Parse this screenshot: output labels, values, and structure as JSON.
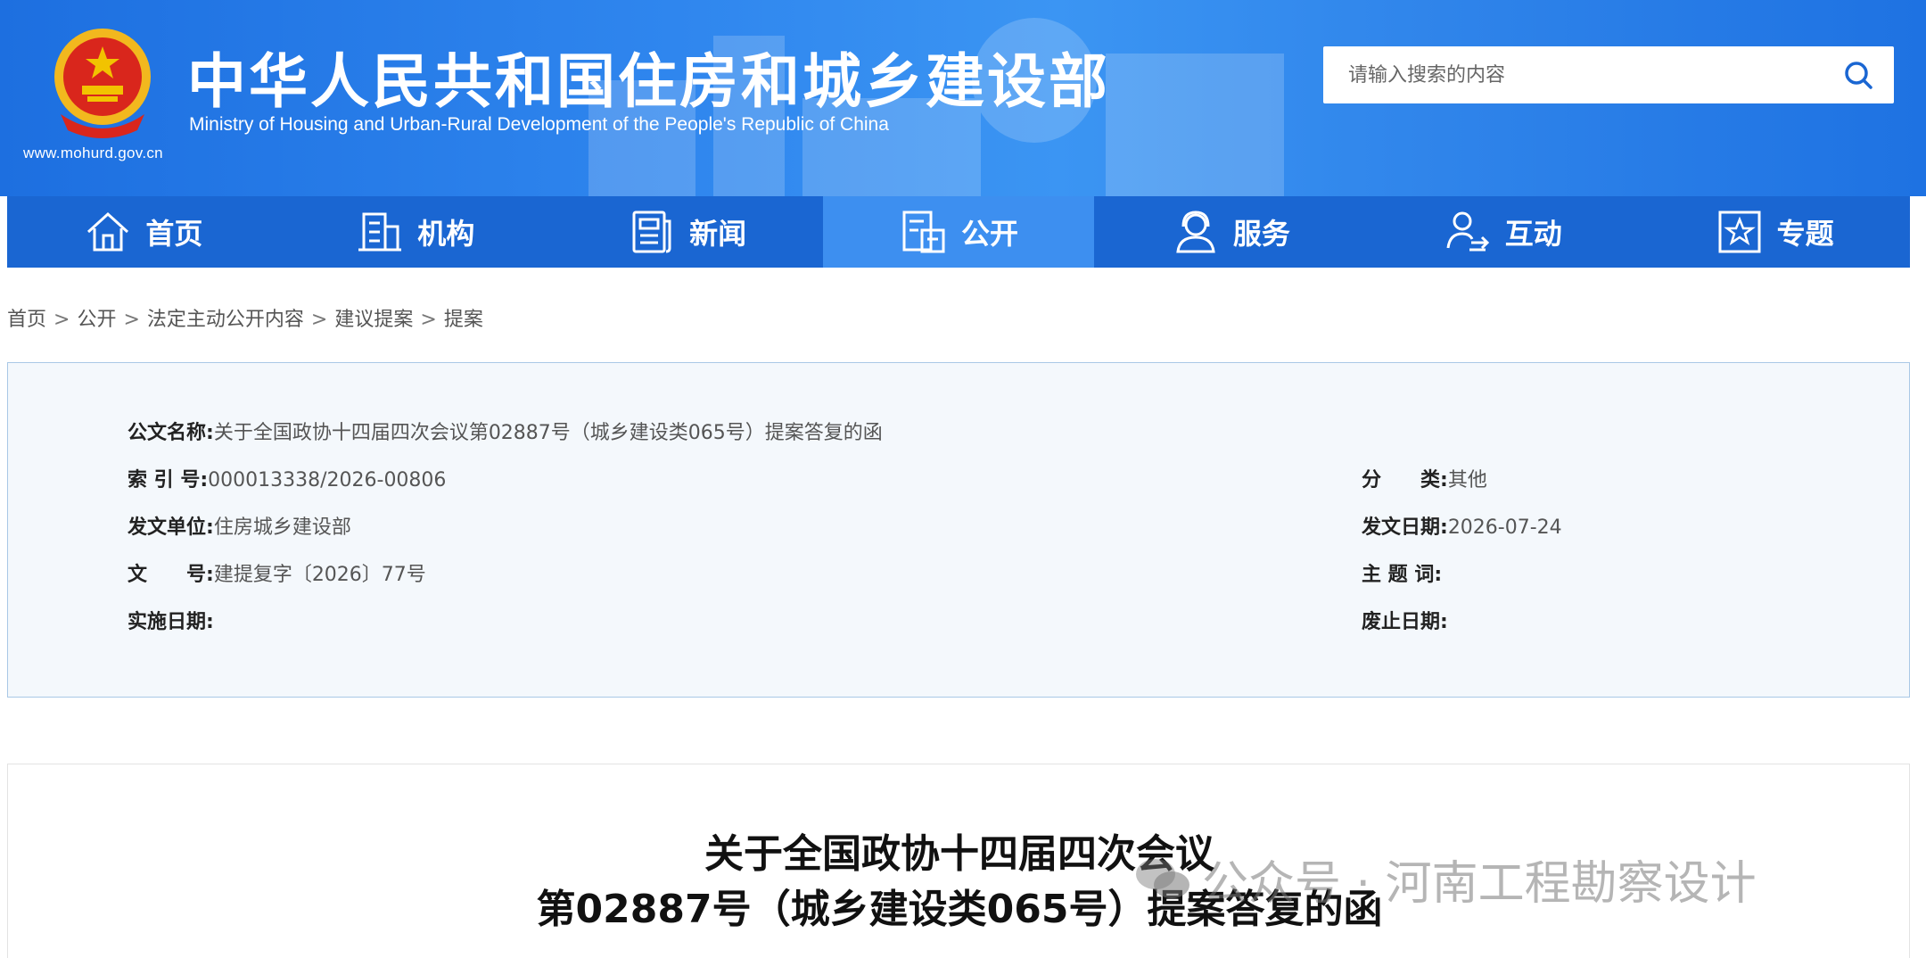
{
  "header": {
    "title_cn": "中华人民共和国住房和城乡建设部",
    "title_en": "Ministry of Housing and Urban-Rural Development of the People's Republic of China",
    "site_url": "www.mohurd.gov.cn",
    "search_placeholder": "请输入搜索的内容"
  },
  "nav": {
    "items": [
      {
        "label": "首页",
        "icon": "home-icon"
      },
      {
        "label": "机构",
        "icon": "building-icon"
      },
      {
        "label": "新闻",
        "icon": "news-icon"
      },
      {
        "label": "公开",
        "icon": "disclosure-icon",
        "active": true
      },
      {
        "label": "服务",
        "icon": "service-icon"
      },
      {
        "label": "互动",
        "icon": "interaction-icon"
      },
      {
        "label": "专题",
        "icon": "topic-icon"
      }
    ]
  },
  "breadcrumb": [
    "首页",
    "公开",
    "法定主动公开内容",
    "建议提案",
    "提案"
  ],
  "info": {
    "doc_name_label": "公文名称:",
    "doc_name_value": "关于全国政协十四届四次会议第02887号（城乡建设类065号）提案答复的函",
    "index_label": "索 引 号:",
    "index_value": "000013338/2026-00806",
    "category_label": "分　　类:",
    "category_value": "其他",
    "issuer_label": "发文单位:",
    "issuer_value": "住房城乡建设部",
    "issue_date_label": "发文日期:",
    "issue_date_value": "2026-07-24",
    "doc_no_label": "文　　号:",
    "doc_no_value": "建提复字〔2026〕77号",
    "keywords_label": "主 题 词:",
    "keywords_value": "",
    "effective_label": "实施日期:",
    "effective_value": "",
    "expire_label": "废止日期:",
    "expire_value": ""
  },
  "article": {
    "title_line1": "关于全国政协十四届四次会议",
    "title_line2": "第02887号（城乡建设类065号）提案答复的函"
  },
  "watermark": {
    "text": "公众号 · 河南工程勘察设计"
  },
  "colors": {
    "nav_bg": "#1a66d2",
    "nav_active": "#3d8ff0",
    "panel_bg": "#f4f8fc",
    "panel_border": "#a9c8e6"
  }
}
